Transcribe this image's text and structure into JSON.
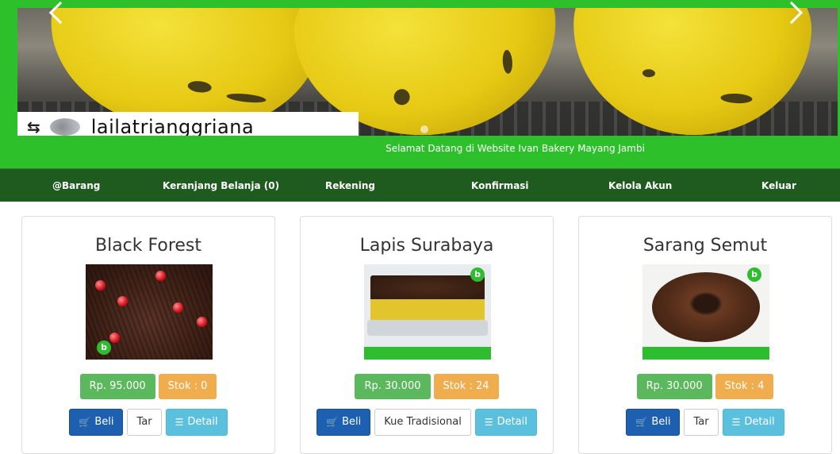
{
  "carousel": {
    "overlay_handle": "lailatrianggriana",
    "prev_icon": "chevron-left-icon",
    "next_icon": "chevron-right-icon"
  },
  "welcome": "Selamat Datang di Website Ivan Bakery Mayang Jambi",
  "nav": [
    "@Barang",
    "Keranjang Belanja (0)",
    "Rekening",
    "Konfirmasi",
    "Kelola Akun",
    "Keluar"
  ],
  "products": [
    {
      "name": "Black Forest",
      "price": "Rp. 95.000",
      "stock": "Stok : 0",
      "buy": "Beli",
      "category": "Tar",
      "detail": "Detail"
    },
    {
      "name": "Lapis Surabaya",
      "price": "Rp. 30.000",
      "stock": "Stok : 24",
      "buy": "Beli",
      "category": "Kue Tradisional",
      "detail": "Detail"
    },
    {
      "name": "Sarang Semut",
      "price": "Rp. 30.000",
      "stock": "Stok : 4",
      "buy": "Beli",
      "category": "Tar",
      "detail": "Detail"
    }
  ],
  "colors": {
    "header_green": "#2ec02a",
    "nav_green": "#1f5a1f",
    "price_badge": "#5cb85c",
    "stock_badge": "#f0ad4e",
    "buy_button": "#1d5fb0",
    "detail_button": "#5bc0de"
  }
}
